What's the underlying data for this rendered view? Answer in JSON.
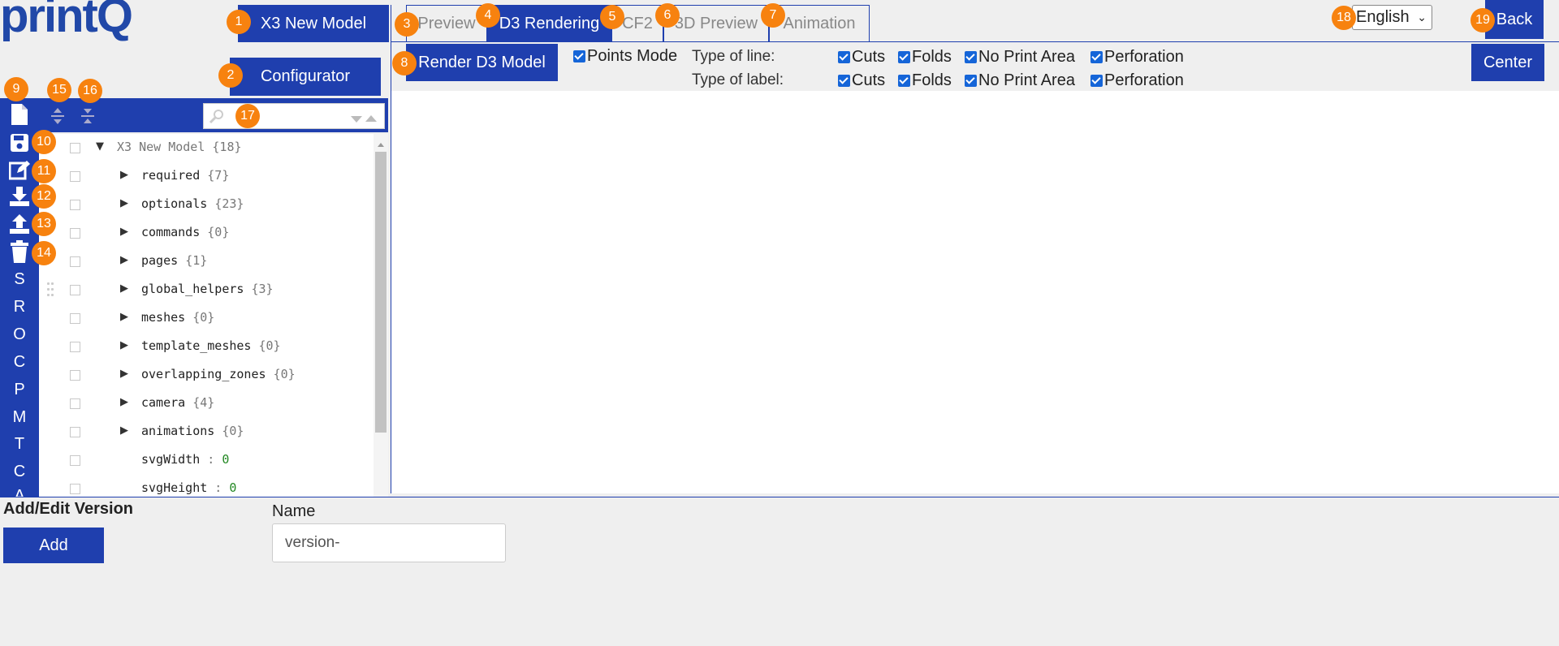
{
  "logo": {
    "text": "printQ"
  },
  "header": {
    "model_button": "X3 New Model",
    "configurator_button": "Configurator",
    "tabs": [
      "Preview",
      "D3 Rendering",
      "CF2",
      "3D Preview",
      "Animation"
    ],
    "active_tab": "D3 Rendering",
    "language": "English",
    "back_button": "Back",
    "center_button": "Center"
  },
  "render_options": {
    "render_button": "Render D3 Model",
    "points_mode": "Points Mode",
    "line_label": "Type of line:",
    "label_label": "Type of label:",
    "line_options": [
      "Cuts",
      "Folds",
      "No Print Area",
      "Perforation"
    ],
    "label_options": [
      "Cuts",
      "Folds",
      "No Print Area",
      "Perforation"
    ]
  },
  "badges": [
    "1",
    "2",
    "3",
    "4",
    "5",
    "6",
    "7",
    "8",
    "9",
    "10",
    "11",
    "12",
    "13",
    "14",
    "15",
    "16",
    "17",
    "18",
    "19"
  ],
  "sidebar": {
    "icons": [
      "new-file-icon",
      "save-icon",
      "edit-icon",
      "download-icon",
      "upload-icon",
      "trash-icon"
    ],
    "letters": [
      "S",
      "R",
      "O",
      "C",
      "P",
      "M",
      "T",
      "C",
      "A"
    ]
  },
  "tree": {
    "root": {
      "key": "X3 New Model",
      "count": "{18}"
    },
    "rows": [
      {
        "key": "required",
        "count": "{7}"
      },
      {
        "key": "optionals",
        "count": "{23}"
      },
      {
        "key": "commands",
        "count": "{0}"
      },
      {
        "key": "pages",
        "count": "{1}"
      },
      {
        "key": "global_helpers",
        "count": "{3}"
      },
      {
        "key": "meshes",
        "count": "{0}"
      },
      {
        "key": "template_meshes",
        "count": "{0}"
      },
      {
        "key": "overlapping_zones",
        "count": "{0}"
      },
      {
        "key": "camera",
        "count": "{4}"
      },
      {
        "key": "animations",
        "count": "{0}"
      }
    ],
    "values": [
      {
        "key": "svgWidth",
        "sep": " : ",
        "value": "0"
      },
      {
        "key": "svgHeight",
        "sep": " : ",
        "value": "0"
      }
    ]
  },
  "version_form": {
    "title": "Add/Edit Version",
    "add_button": "Add",
    "name_label": "Name",
    "name_value": "version-"
  },
  "colors": {
    "primary": "#1f3fae",
    "badge": "#f7820f",
    "checkbox": "#1565d8"
  }
}
